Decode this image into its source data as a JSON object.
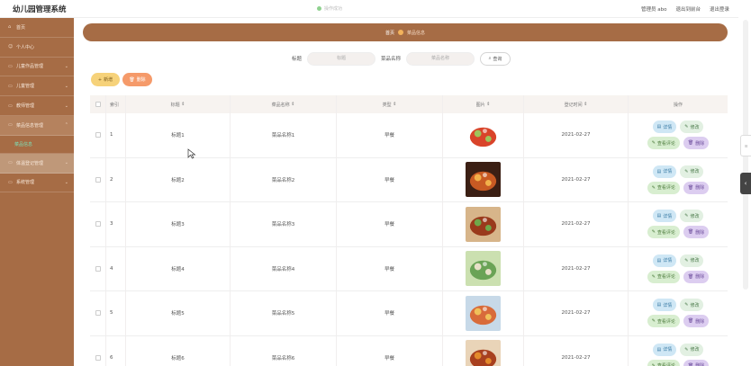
{
  "app": {
    "title": "幼儿园管理系统",
    "status_text": "操作成功"
  },
  "topbar": {
    "user_label": "管理员 abo",
    "back_label": "退出到前台",
    "logout_label": "退出登录"
  },
  "sidebar": {
    "items": [
      {
        "label": "首页",
        "icon": "home-icon"
      },
      {
        "label": "个人中心",
        "icon": "user-icon"
      },
      {
        "label": "儿童作品管理",
        "icon": "folder-icon"
      },
      {
        "label": "儿童管理",
        "icon": "folder-icon"
      },
      {
        "label": "教师管理",
        "icon": "folder-icon"
      },
      {
        "label": "菜品信息管理",
        "icon": "folder-icon"
      },
      {
        "label": "体温登记管理",
        "icon": "folder-icon"
      },
      {
        "label": "系统管理",
        "icon": "folder-icon"
      }
    ],
    "sub_item": "菜品信息"
  },
  "breadcrumb": {
    "home": "首页",
    "current": "菜品信息"
  },
  "search": {
    "title_label": "标题",
    "title_placeholder": "标题",
    "name_label": "菜品名称",
    "name_placeholder": "菜品名称",
    "button_label": "查询"
  },
  "actions": {
    "add_label": "新增",
    "delete_label": "删除"
  },
  "table": {
    "headers": {
      "index": "索引",
      "title": "标题",
      "name": "菜品名称",
      "type": "类型",
      "image": "图片",
      "date": "登记时间",
      "ops": "操作"
    },
    "rows": [
      {
        "index": "1",
        "title": "标题1",
        "name": "菜品名称1",
        "type": "早餐",
        "date": "2021-02-27"
      },
      {
        "index": "2",
        "title": "标题2",
        "name": "菜品名称2",
        "type": "早餐",
        "date": "2021-02-27"
      },
      {
        "index": "3",
        "title": "标题3",
        "name": "菜品名称3",
        "type": "早餐",
        "date": "2021-02-27"
      },
      {
        "index": "4",
        "title": "标题4",
        "name": "菜品名称4",
        "type": "早餐",
        "date": "2021-02-27"
      },
      {
        "index": "5",
        "title": "标题5",
        "name": "菜品名称5",
        "type": "早餐",
        "date": "2021-02-27"
      },
      {
        "index": "6",
        "title": "标题6",
        "name": "菜品名称6",
        "type": "早餐",
        "date": "2021-02-27"
      }
    ],
    "op_labels": {
      "detail": "详情",
      "edit": "修改",
      "comment": "查看评论",
      "delete": "删除"
    }
  },
  "colors": {
    "sidebar": "#a66c45",
    "accent": "#f6d27a",
    "delete": "#f59a6a"
  }
}
